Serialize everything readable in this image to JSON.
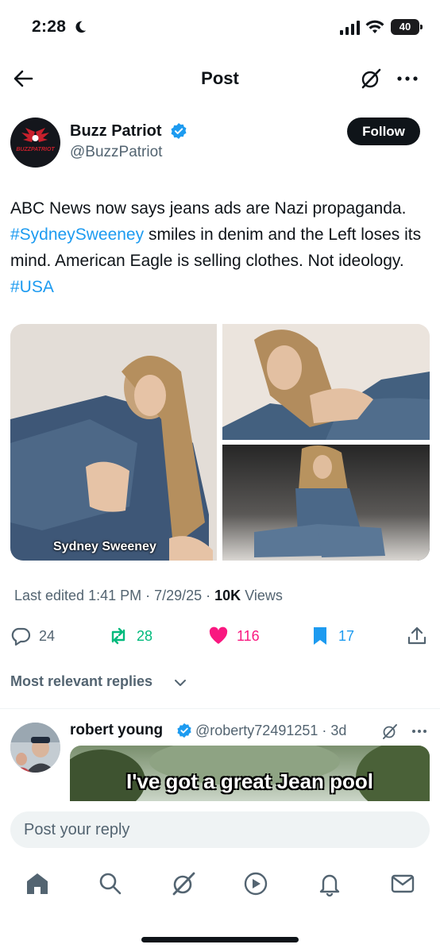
{
  "status_bar": {
    "time": "2:28",
    "battery": "40"
  },
  "nav": {
    "title": "Post"
  },
  "author": {
    "name": "Buzz Patriot",
    "handle": "@BuzzPatriot",
    "avatar_text": "BUZZPATRIOT",
    "follow_label": "Follow"
  },
  "post": {
    "text_1": "ABC News now says jeans ads are Nazi propaganda. ",
    "hashtag_1": "#SydneySweeney",
    "text_2": " smiles in denim and the Left loses its mind. American Eagle is selling clothes. Not ideology. ",
    "hashtag_2": "#USA",
    "image_caption": "Sydney Sweeney"
  },
  "meta": {
    "edited": "Last edited 1:41 PM · 7/29/25",
    "separator": " · ",
    "views_count": "10K",
    "views_label": " Views"
  },
  "actions": {
    "replies": "24",
    "reposts": "28",
    "likes": "116",
    "bookmarks": "17"
  },
  "sort": {
    "label": "Most relevant replies"
  },
  "reply": {
    "name": "robert young",
    "handle": "@roberty72491251 · 3d",
    "meme_text": "I've got a great Jean pool"
  },
  "composer": {
    "placeholder": "Post your reply"
  },
  "colors": {
    "accent": "#1d9bf0",
    "repost": "#00ba7c",
    "like": "#f91880",
    "text": "#0f1419",
    "muted": "#536471"
  },
  "icons": [
    "back-arrow-icon",
    "grok-icon",
    "more-icon",
    "verified-badge-icon",
    "reply-icon",
    "repost-icon",
    "heart-icon",
    "bookmark-icon",
    "share-icon",
    "chevron-down-icon",
    "home-icon",
    "search-icon",
    "play-icon",
    "bell-icon",
    "mail-icon"
  ]
}
